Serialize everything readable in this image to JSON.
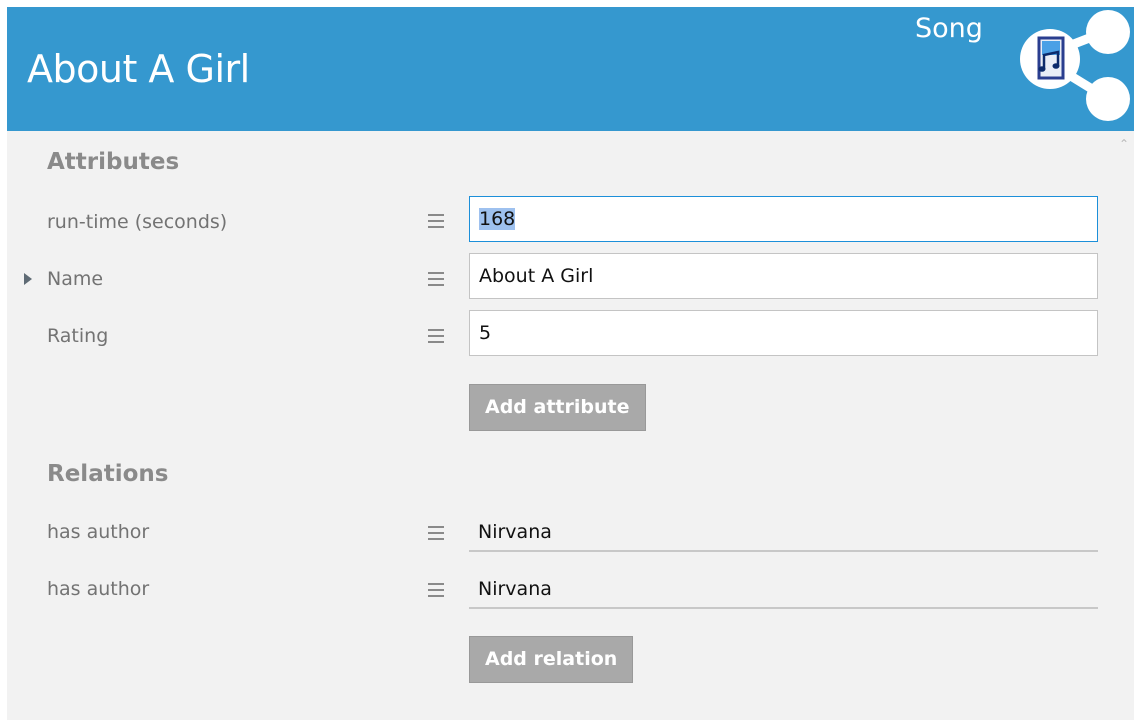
{
  "header": {
    "title": "About A Girl",
    "type_label": "Song",
    "icon": "music-share-icon",
    "color": "#3598cf"
  },
  "attributes": {
    "section_title": "Attributes",
    "rows": [
      {
        "label": "run-time (seconds)",
        "value": "168",
        "focused": true,
        "selected": true
      },
      {
        "label": "Name",
        "value": "About A Girl",
        "current_row": true
      },
      {
        "label": "Rating",
        "value": "5"
      }
    ],
    "add_button_label": "Add attribute"
  },
  "relations": {
    "section_title": "Relations",
    "rows": [
      {
        "label": "has author",
        "value": "Nirvana"
      },
      {
        "label": "has author",
        "value": "Nirvana"
      }
    ],
    "add_button_label": "Add relation"
  },
  "colors": {
    "button_bg": "#a9a9a9",
    "panel_bg": "#f2f2f2",
    "focus_border": "#1c8fd9",
    "selection": "#9ec1ef"
  }
}
